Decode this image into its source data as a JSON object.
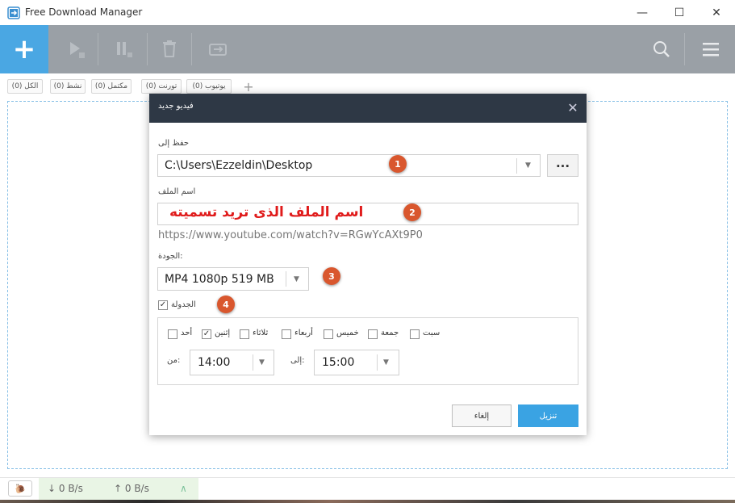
{
  "window": {
    "title": "Free Download Manager",
    "minimize_glyph": "—",
    "maximize_glyph": "☐",
    "close_glyph": "✕"
  },
  "toolbar": {
    "add_glyph": "+",
    "icons": [
      "play-icon",
      "pause-icon",
      "trash-icon",
      "move-icon",
      "search-icon",
      "hamburger-menu-icon"
    ]
  },
  "filter_tabs": [
    {
      "label": "الكل (0)"
    },
    {
      "label": "نشط (0)"
    },
    {
      "label": "مكتمل (0)"
    },
    {
      "label": "تورنت (0)"
    },
    {
      "label": "يوتيوب (0)"
    }
  ],
  "filter_add_glyph": "+",
  "dialog": {
    "title": "فيديو جديد",
    "save_to_label": "حفظ إلى",
    "save_to_value": "C:\\Users\\Ezzeldin\\Desktop",
    "browse_label": "...",
    "filename_label": "اسم الملف",
    "filename_value": "اسم الملف الذى تريد تسميته",
    "url": "https://www.youtube.com/watch?v=RGwYcAXt9P0",
    "quality_label": "الجودة:",
    "quality_value": "MP4 1080p 519 MB",
    "schedule_label": "الجدولة",
    "schedule_checked": true,
    "days": [
      {
        "label": "أحد",
        "checked": false
      },
      {
        "label": "إثنين",
        "checked": true
      },
      {
        "label": "ثلاثاء",
        "checked": false
      },
      {
        "label": "أربعاء",
        "checked": false
      },
      {
        "label": "خميس",
        "checked": false
      },
      {
        "label": "جمعة",
        "checked": false
      },
      {
        "label": "سبت",
        "checked": false
      }
    ],
    "from_label": "من:",
    "from_value": "14:00",
    "to_label": "إلى:",
    "to_value": "15:00",
    "cancel_label": "إلغاء",
    "download_label": "تنزيل",
    "close_glyph": "✕"
  },
  "badges": [
    "1",
    "2",
    "3",
    "4"
  ],
  "status": {
    "snail_glyph": "🐌",
    "download_speed": "↓ 0 B/s",
    "upload_speed": "↑ 0 B/s",
    "collapse_glyph": "∧"
  },
  "colors": {
    "accent": "#4aa7e3",
    "toolbar": "#9aa0a6",
    "dialog_header": "#2e3845",
    "badge": "#d9572e",
    "filename_text": "#e01b1b"
  }
}
